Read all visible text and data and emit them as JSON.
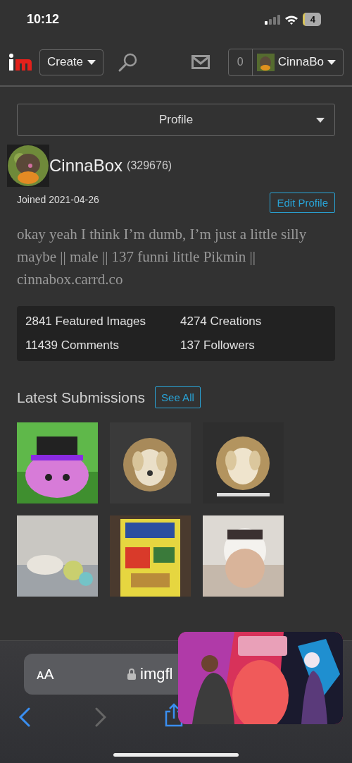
{
  "status_bar": {
    "time": "10:12",
    "battery": "4"
  },
  "nav": {
    "create": "Create",
    "notification_count": "0",
    "username": "CinnaBo"
  },
  "section_select": {
    "value": "Profile"
  },
  "profile": {
    "name": "CinnaBox",
    "id": "(329676)",
    "joined": "Joined 2021-04-26",
    "edit_button": "Edit Profile",
    "bio": "okay yeah I think I’m dumb, I’m just a little silly maybe || male || 137 funni little Pikmin || cinnabox.carrd.co"
  },
  "stats": [
    "2841 Featured Images",
    "4274 Creations",
    "11439 Comments",
    "137 Followers"
  ],
  "latest_submissions": {
    "title": "Latest Submissions",
    "see_all": "See All"
  },
  "browser": {
    "text_size": "ᴀA",
    "url": "imgfl"
  }
}
